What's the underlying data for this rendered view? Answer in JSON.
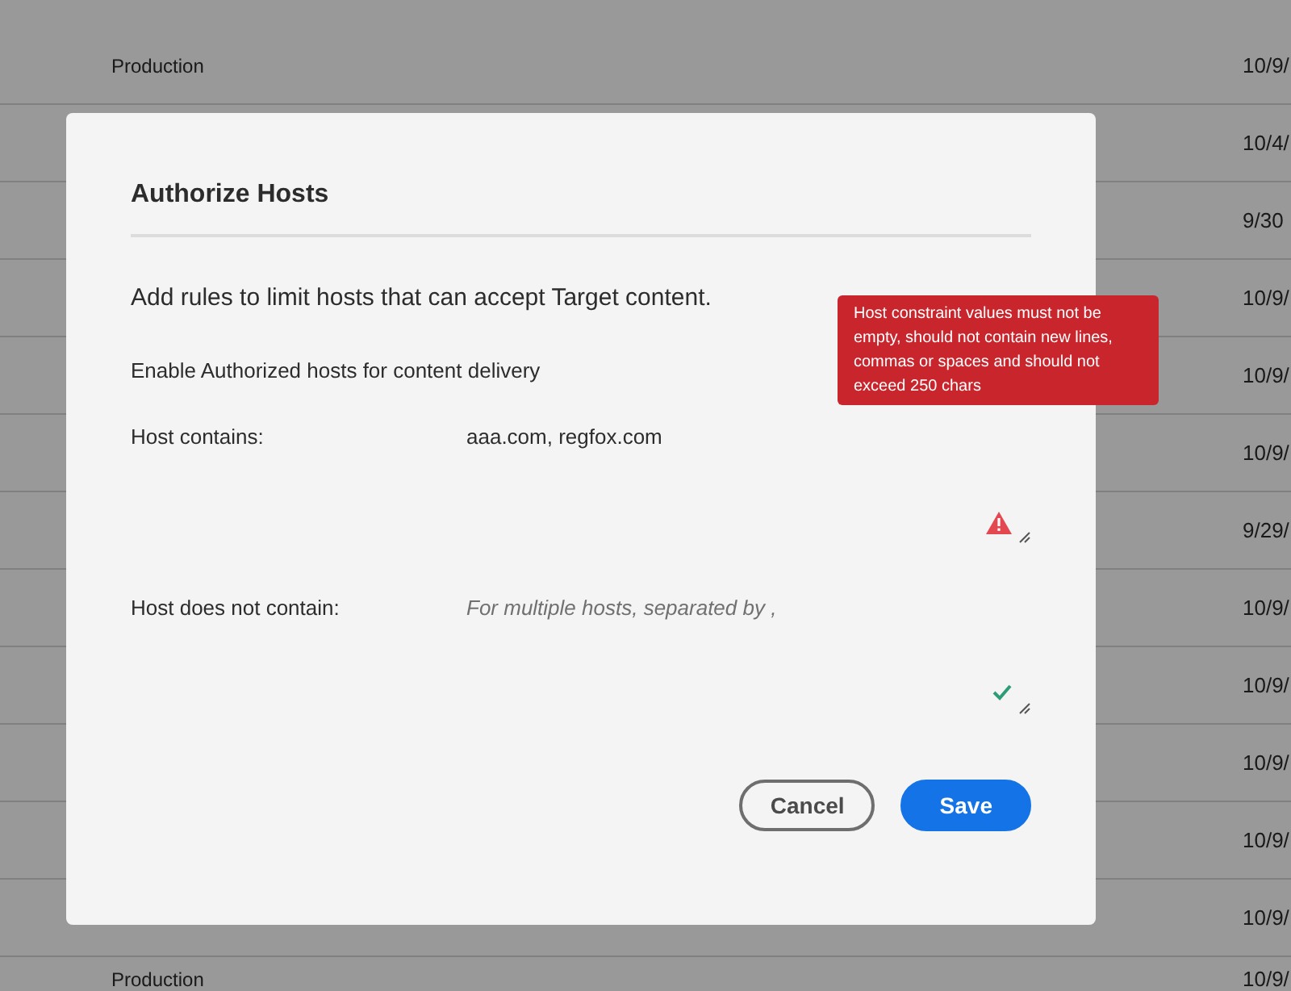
{
  "background_table": {
    "rows": [
      {
        "column_1": "Production",
        "column_2": "10/9/"
      },
      {
        "column_2": "10/4/"
      },
      {
        "column_2": "9/30"
      },
      {
        "column_2": "10/9/"
      },
      {
        "column_2": "10/9/"
      },
      {
        "column_2": "10/9/"
      },
      {
        "column_2": "9/29/"
      },
      {
        "column_2": "10/9/"
      },
      {
        "column_2": "10/9/"
      },
      {
        "column_2": "10/9/"
      },
      {
        "column_2": "10/9/"
      },
      {
        "column_2": "10/9/"
      },
      {
        "column_1": "Production",
        "column_2": "10/9/"
      }
    ]
  },
  "dialog": {
    "title": "Authorize Hosts",
    "description": "Add rules to limit hosts that can accept Target content.",
    "toggle_label": "Enable Authorized hosts for content delivery",
    "fields": [
      {
        "label": "Host contains:",
        "value": "aaa.com, regfox.com",
        "valid": false,
        "error": "Host constraint values must not be empty, should not contain new lines, commas or spaces and should not exceed 250 chars"
      },
      {
        "label": "Host does not contain:",
        "placeholder": "For multiple hosts, separated by ,",
        "valid": true
      }
    ],
    "buttons": [
      {
        "label": "Cancel",
        "kind": "secondary"
      },
      {
        "label": "Save",
        "kind": "primary"
      }
    ]
  }
}
